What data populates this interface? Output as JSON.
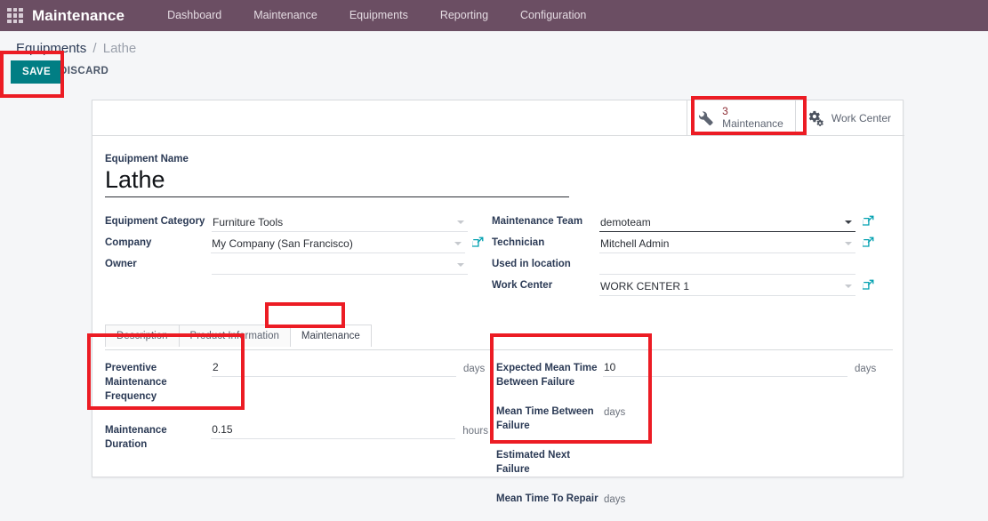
{
  "navbar": {
    "apps_icon": "apps-grid-icon",
    "brand": "Maintenance",
    "menu": [
      {
        "label": "Dashboard"
      },
      {
        "label": "Maintenance"
      },
      {
        "label": "Equipments"
      },
      {
        "label": "Reporting"
      },
      {
        "label": "Configuration"
      }
    ]
  },
  "control_panel": {
    "breadcrumb": {
      "parent": "Equipments",
      "separator": "/",
      "current": "Lathe"
    },
    "save_label": "SAVE",
    "discard_label": "DISCARD"
  },
  "stat_buttons": [
    {
      "icon": "wrench-icon",
      "count": "3",
      "label": "Maintenance"
    },
    {
      "icon": "gears-icon",
      "label": "Work Center"
    }
  ],
  "form": {
    "title_label": "Equipment Name",
    "title_value": "Lathe",
    "left_fields": [
      {
        "label": "Equipment Category",
        "value": "Furniture Tools",
        "placeholder": "",
        "has_caret": true,
        "caret_dark": false,
        "has_ext_link": false,
        "focused": false
      },
      {
        "label": "Company",
        "value": "My Company (San Francisco)",
        "placeholder": "",
        "has_caret": true,
        "caret_dark": false,
        "has_ext_link": true,
        "focused": false
      },
      {
        "label": "Owner",
        "value": "",
        "placeholder": "",
        "has_caret": true,
        "caret_dark": false,
        "has_ext_link": false,
        "focused": false
      }
    ],
    "right_fields": [
      {
        "label": "Maintenance Team",
        "value": "demoteam",
        "placeholder": "",
        "has_caret": true,
        "caret_dark": true,
        "has_ext_link": true,
        "focused": true
      },
      {
        "label": "Technician",
        "value": "Mitchell Admin",
        "placeholder": "",
        "has_caret": true,
        "caret_dark": false,
        "has_ext_link": true,
        "focused": false
      },
      {
        "label": "Used in location",
        "value": "",
        "placeholder": "",
        "has_caret": false,
        "caret_dark": false,
        "has_ext_link": false,
        "focused": false
      },
      {
        "label": "Work Center",
        "value": "WORK CENTER 1",
        "placeholder": "",
        "has_caret": true,
        "caret_dark": false,
        "has_ext_link": true,
        "focused": false
      }
    ]
  },
  "notebook": {
    "tabs": [
      {
        "label": "Description",
        "active": false
      },
      {
        "label": "Product Information",
        "active": false
      },
      {
        "label": "Maintenance",
        "active": true
      }
    ],
    "maintenance_left": [
      {
        "label": "Preventive Maintenance Frequency",
        "value": "2",
        "suffix": "days"
      },
      {
        "label": "Maintenance Duration",
        "value": "0.15",
        "suffix": "hours"
      }
    ],
    "maintenance_right": [
      {
        "label": "Expected Mean Time Between Failure",
        "value": "10",
        "suffix": "days",
        "suffix_far": true,
        "underline": true
      },
      {
        "label": "Mean Time Between Failure",
        "value": "",
        "suffix": "days",
        "suffix_far": false,
        "underline": false
      },
      {
        "label": "Estimated Next Failure",
        "value": "",
        "suffix": "",
        "suffix_far": false,
        "underline": false
      },
      {
        "label": "Mean Time To Repair",
        "value": "",
        "suffix": "days",
        "suffix_far": false,
        "underline": false
      }
    ]
  },
  "annotations": {
    "boxes": [
      {
        "name": "save-button-highlight"
      },
      {
        "name": "maintenance-stat-highlight"
      },
      {
        "name": "maintenance-tab-highlight"
      },
      {
        "name": "preventive-fields-highlight"
      },
      {
        "name": "failure-fields-highlight"
      }
    ],
    "color": "#ec1c24"
  },
  "colors": {
    "navbar": "#6b4e63",
    "save_button": "#017e84",
    "accent_link": "#00a0b0",
    "stat_count": "#8c2b33",
    "page_background": "#f5f6f8"
  }
}
